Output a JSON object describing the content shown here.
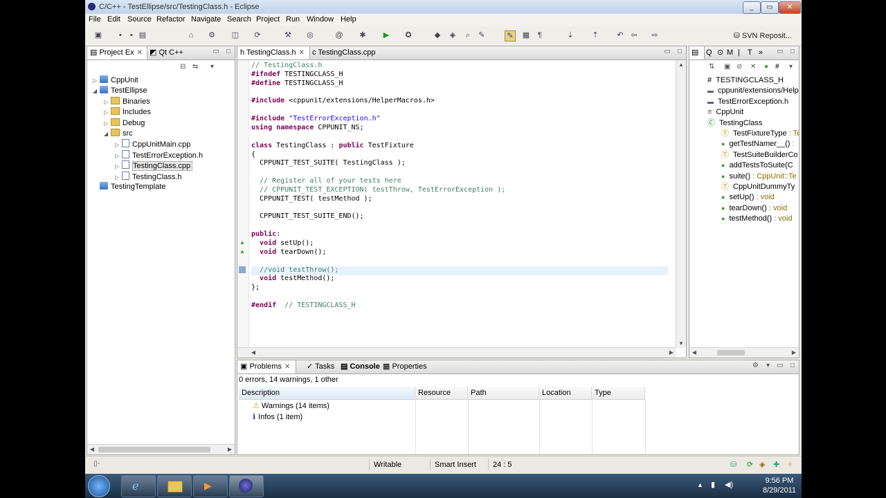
{
  "window": {
    "title": "C/C++ - TestEllipse/src/TestingClass.h - Eclipse"
  },
  "menu": [
    "File",
    "Edit",
    "Source",
    "Refactor",
    "Navigate",
    "Search",
    "Project",
    "Run",
    "Window",
    "Help"
  ],
  "toolbar": {
    "svn_label": "SVN Reposit..."
  },
  "project_explorer": {
    "tabs": [
      {
        "label": "Project Ex"
      },
      {
        "label": "Qt C++"
      }
    ],
    "tree": [
      {
        "label": "CppUnit",
        "depth": 0,
        "kind": "project",
        "expanded": false
      },
      {
        "label": "TestEllipse",
        "depth": 0,
        "kind": "project",
        "expanded": true
      },
      {
        "label": "Binaries",
        "depth": 1,
        "kind": "folder",
        "expanded": false
      },
      {
        "label": "Includes",
        "depth": 1,
        "kind": "folder",
        "expanded": false
      },
      {
        "label": "Debug",
        "depth": 1,
        "kind": "folder",
        "expanded": false
      },
      {
        "label": "src",
        "depth": 1,
        "kind": "folder",
        "expanded": true
      },
      {
        "label": "CppUnitMain.cpp",
        "depth": 2,
        "kind": "file",
        "expanded": false
      },
      {
        "label": "TestErrorException.h",
        "depth": 2,
        "kind": "file",
        "expanded": false
      },
      {
        "label": "TestingClass.cpp",
        "depth": 2,
        "kind": "file",
        "expanded": false,
        "selected": true
      },
      {
        "label": "TestingClass.h",
        "depth": 2,
        "kind": "file",
        "expanded": false
      },
      {
        "label": "TestingTemplate",
        "depth": 0,
        "kind": "project",
        "expanded": null
      }
    ]
  },
  "editor": {
    "tabs": [
      {
        "label": "TestingClass.h",
        "active": true
      },
      {
        "label": "TestingClass.cpp",
        "active": false
      }
    ],
    "lines": [
      "// TestingClass.h",
      "#ifndef TESTINGCLASS_H",
      "#define TESTINGCLASS_H",
      "",
      "#include <cppunit/extensions/HelperMacros.h>",
      "",
      "#include \"TestErrorException.h\"",
      "using namespace CPPUNIT_NS;",
      "",
      "class TestingClass : public TestFixture",
      "{",
      "  CPPUNIT_TEST_SUITE( TestingClass );",
      "",
      "  // Register all of your tests here",
      "  // CPPUNIT_TEST_EXCEPTION( testThrow, TestErrorException );",
      "  CPPUNIT_TEST( testMethod );",
      "",
      "  CPPUNIT_TEST_SUITE_END();",
      "",
      "public:",
      "  void setUp();",
      "  void tearDown();",
      "",
      "  //void testThrow();",
      "  void testMethod();",
      "};",
      "",
      "#endif  // TESTINGCLASS_H"
    ]
  },
  "outline": {
    "tabs": [
      "Q",
      "M",
      "T"
    ],
    "items": [
      {
        "label": "TESTINGCLASS_H",
        "type": "",
        "depth": 0,
        "icon": "#"
      },
      {
        "label": "cppunit/extensions/Help",
        "type": "",
        "depth": 0,
        "icon": "include"
      },
      {
        "label": "TestErrorException.h",
        "type": "",
        "depth": 0,
        "icon": "include"
      },
      {
        "label": "CppUnit",
        "type": "",
        "depth": 0,
        "icon": "namespace"
      },
      {
        "label": "TestingClass",
        "type": "",
        "depth": 0,
        "icon": "class"
      },
      {
        "label": "TestFixtureType",
        "type": " : Te",
        "depth": 1,
        "icon": "typedef"
      },
      {
        "label": "getTestNamer__()",
        "type": " :",
        "depth": 1,
        "icon": "static-method"
      },
      {
        "label": "TestSuiteBuilderCo",
        "type": "",
        "depth": 1,
        "icon": "typedef"
      },
      {
        "label": "addTestsToSuite(C",
        "type": "",
        "depth": 1,
        "icon": "static-method"
      },
      {
        "label": "suite()",
        "type": " : CppUnit::Te",
        "depth": 1,
        "icon": "static-method"
      },
      {
        "label": "CppUnitDummyTy",
        "type": "",
        "depth": 1,
        "icon": "typedef"
      },
      {
        "label": "setUp()",
        "type": " : void",
        "depth": 1,
        "icon": "method"
      },
      {
        "label": "tearDown()",
        "type": " : void",
        "depth": 1,
        "icon": "method"
      },
      {
        "label": "testMethod()",
        "type": " : void",
        "depth": 1,
        "icon": "method"
      }
    ]
  },
  "bottom": {
    "tabs": [
      {
        "label": "Problems",
        "active": true
      },
      {
        "label": "Tasks"
      },
      {
        "label": "Console",
        "bold": true
      },
      {
        "label": "Properties"
      }
    ],
    "summary": "0 errors, 14 warnings, 1 other",
    "columns": [
      "Description",
      "Resource",
      "Path",
      "Location",
      "Type"
    ],
    "rows": [
      {
        "label": "Warnings (14 items)",
        "icon": "warning"
      },
      {
        "label": "Infos (1 item)",
        "icon": "info"
      }
    ]
  },
  "status": {
    "writable": "Writable",
    "insert_mode": "Smart Insert",
    "position": "24 : 5"
  },
  "taskbar": {
    "time": "9:56 PM",
    "date": "8/29/2011"
  },
  "colors": {
    "keyword": "#7f0055",
    "comment": "#3f7f5f",
    "string": "#2a00ff",
    "taskbar": "#1c2f44"
  }
}
